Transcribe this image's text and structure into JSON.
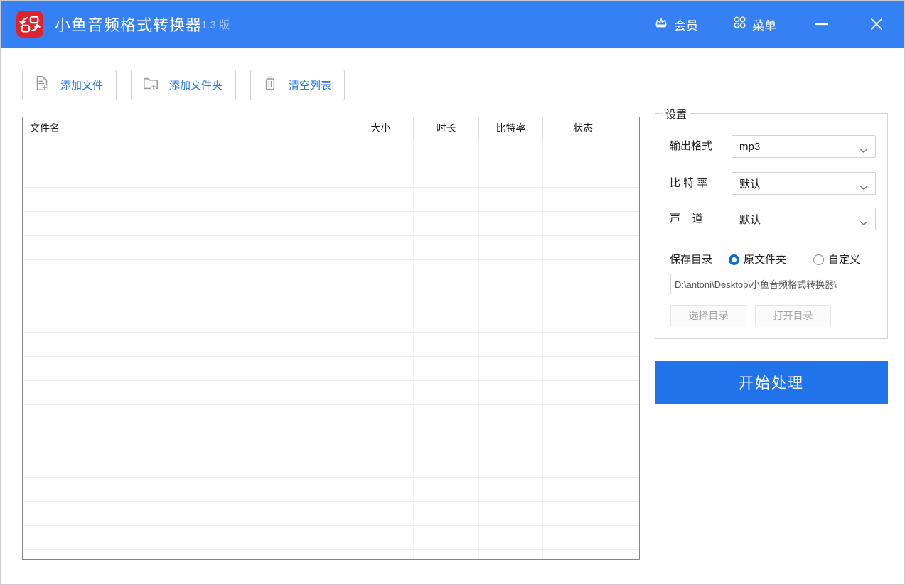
{
  "titlebar": {
    "title": "小鱼音频格式转换器",
    "version": "1.3 版",
    "member_label": "会员",
    "menu_label": "菜单"
  },
  "toolbar": {
    "add_files_label": "添加文件",
    "add_folder_label": "添加文件夹",
    "clear_list_label": "清空列表"
  },
  "file_table": {
    "columns": [
      "文件名",
      "大小",
      "时长",
      "比特率",
      "状态"
    ],
    "rows": [],
    "visible_empty_rows": 18
  },
  "settings": {
    "legend": "设置",
    "output_format": {
      "label": "输出格式",
      "value": "mp3"
    },
    "bitrate": {
      "label": "比 特 率",
      "value": "默认"
    },
    "channel": {
      "label": "声    道",
      "value": "默认"
    },
    "save_dir": {
      "label": "保存目录",
      "options": [
        {
          "label": "原文件夹",
          "selected": true
        },
        {
          "label": "自定义",
          "selected": false
        }
      ],
      "path": "D:\\antoni\\Desktop\\小鱼音频格式转换器\\",
      "choose_button": "选择目录",
      "open_button": "打开目录"
    }
  },
  "start_button_label": "开始处理",
  "colors": {
    "titlebar": "#3580f3",
    "accent": "#2e7bf0",
    "start-button": "#2173ea",
    "logo-red": "#e0222d"
  }
}
